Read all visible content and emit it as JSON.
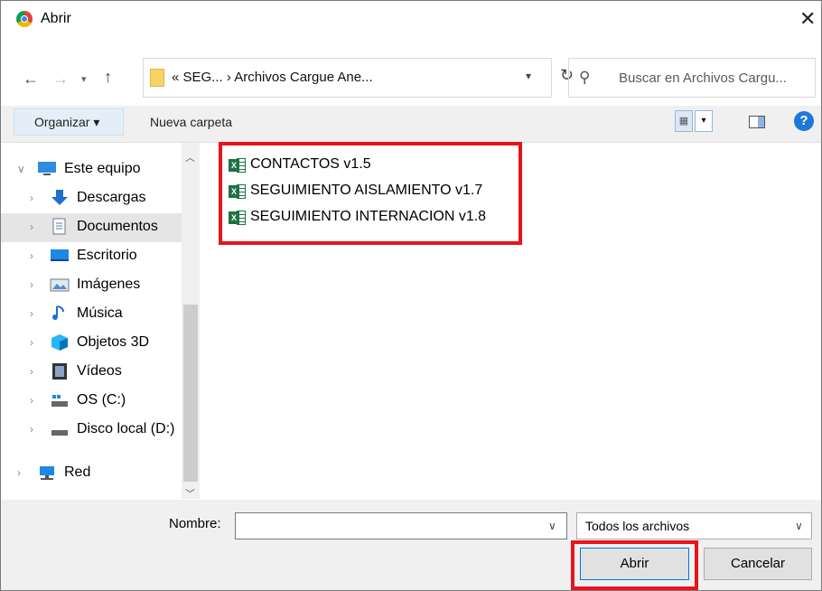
{
  "window": {
    "title": "Abrir"
  },
  "address": {
    "crumbs": "« SEG... › Archivos Cargue Ane...",
    "search_placeholder": "Buscar en Archivos Cargu..."
  },
  "toolbar": {
    "organize_label": "Organizar ▾",
    "new_folder_label": "Nueva carpeta"
  },
  "tree": {
    "items": [
      {
        "label": "Este equipo",
        "icon": "computer-icon"
      },
      {
        "label": "Descargas",
        "icon": "download-icon"
      },
      {
        "label": "Documentos",
        "icon": "document-icon"
      },
      {
        "label": "Escritorio",
        "icon": "desktop-icon"
      },
      {
        "label": "Imágenes",
        "icon": "pictures-icon"
      },
      {
        "label": "Música",
        "icon": "music-icon"
      },
      {
        "label": "Objetos 3D",
        "icon": "3d-objects-icon"
      },
      {
        "label": "Vídeos",
        "icon": "videos-icon"
      },
      {
        "label": "OS (C:)",
        "icon": "drive-c-icon"
      },
      {
        "label": "Disco local (D:)",
        "icon": "drive-d-icon"
      },
      {
        "label": "Red",
        "icon": "network-icon"
      }
    ]
  },
  "files": [
    {
      "name": "CONTACTOS v1.5"
    },
    {
      "name": "SEGUIMIENTO AISLAMIENTO v1.7"
    },
    {
      "name": "SEGUIMIENTO INTERNACION v1.8"
    }
  ],
  "bottom": {
    "name_label": "Nombre:",
    "name_value": "",
    "file_type": "Todos los archivos",
    "open_label": "Abrir",
    "cancel_label": "Cancelar"
  },
  "colors": {
    "highlight": "#e8141b",
    "selected_bg": "#e5e5e5",
    "accent": "#0078d7"
  }
}
